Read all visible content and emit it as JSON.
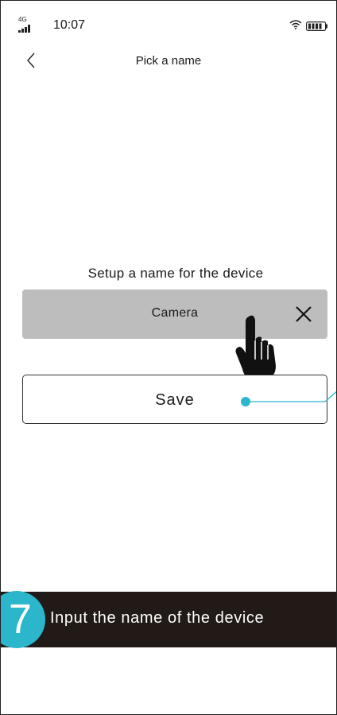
{
  "status_bar": {
    "network": "4G",
    "time": "10:07",
    "icons": [
      "signal-icon",
      "wifi-icon",
      "battery-icon"
    ]
  },
  "nav": {
    "title": "Pick a name",
    "back_icon": "chevron-left-icon"
  },
  "form": {
    "label": "Setup a name for the device",
    "name_value": "Camera",
    "clear_icon": "close-icon",
    "save_label": "Save",
    "field_color": "#bdbdbd"
  },
  "instruction": {
    "step": "7",
    "text": "Input the name of the device",
    "badge_color": "#2bb6cc",
    "banner_color": "#211a17"
  }
}
